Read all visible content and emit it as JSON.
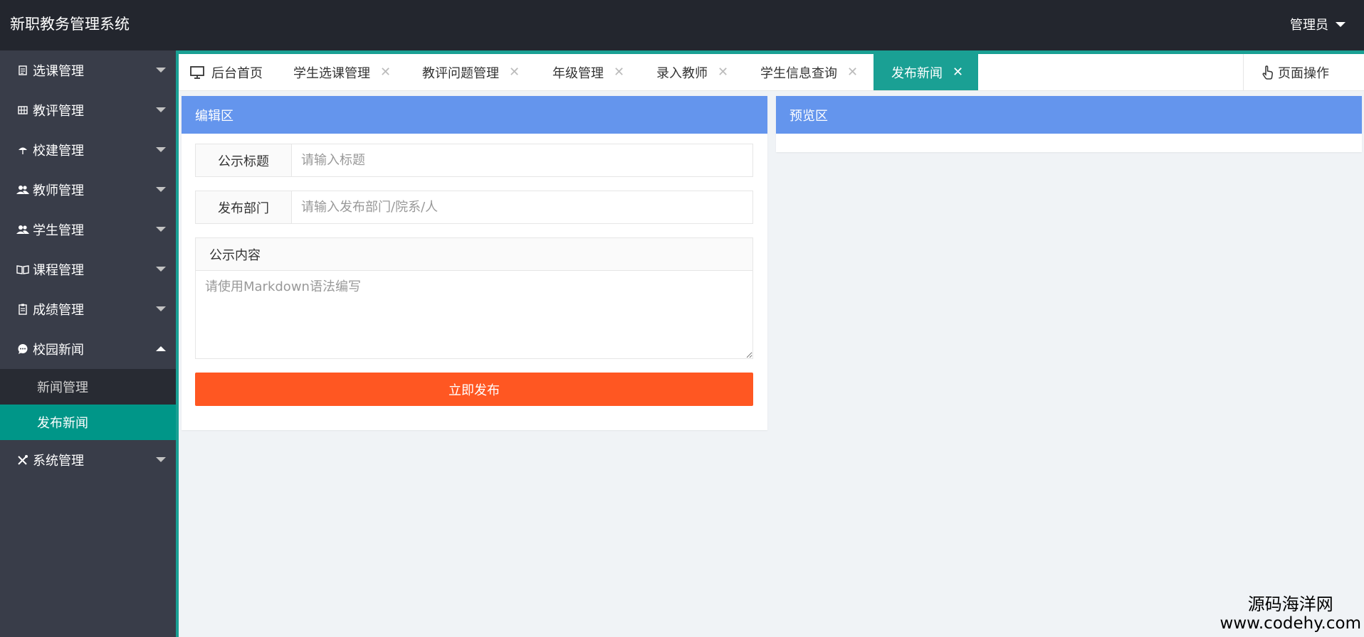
{
  "app": {
    "title": "新职教务管理系统",
    "user_name": "管理员"
  },
  "colors": {
    "header_bg": "#23262e",
    "sidebar_bg": "#393d49",
    "accent": "#1aa094",
    "subnav_active": "#009688",
    "panel_header": "#6495ed",
    "publish_button": "#ff5722"
  },
  "sidebar": {
    "items": [
      {
        "label": "选课管理",
        "icon": "document-icon"
      },
      {
        "label": "教评管理",
        "icon": "grid-icon"
      },
      {
        "label": "校建管理",
        "icon": "umbrella-icon"
      },
      {
        "label": "教师管理",
        "icon": "users-icon"
      },
      {
        "label": "学生管理",
        "icon": "users-icon"
      },
      {
        "label": "课程管理",
        "icon": "book-icon"
      },
      {
        "label": "成绩管理",
        "icon": "clipboard-icon"
      },
      {
        "label": "校园新闻",
        "icon": "chat-icon",
        "expanded": true
      },
      {
        "label": "系统管理",
        "icon": "tools-icon"
      }
    ],
    "news_children": [
      {
        "label": "新闻管理",
        "active": false
      },
      {
        "label": "发布新闻",
        "active": true
      }
    ]
  },
  "tabs": {
    "home": "后台首页",
    "items": [
      {
        "label": "学生选课管理"
      },
      {
        "label": "教评问题管理"
      },
      {
        "label": "年级管理"
      },
      {
        "label": "录入教师"
      },
      {
        "label": "学生信息查询"
      },
      {
        "label": "发布新闻",
        "active": true
      }
    ],
    "close_glyph": "✕",
    "page_ops": "页面操作"
  },
  "editor": {
    "header": "编辑区",
    "title_label": "公示标题",
    "title_placeholder": "请输入标题",
    "dept_label": "发布部门",
    "dept_placeholder": "请输入发布部门/院系/人",
    "content_label": "公示内容",
    "content_placeholder": "请使用Markdown语法编写",
    "publish_label": "立即发布"
  },
  "preview": {
    "header": "预览区"
  },
  "watermark": {
    "line1": "源码海洋网",
    "line2": "www.codehy.com"
  }
}
